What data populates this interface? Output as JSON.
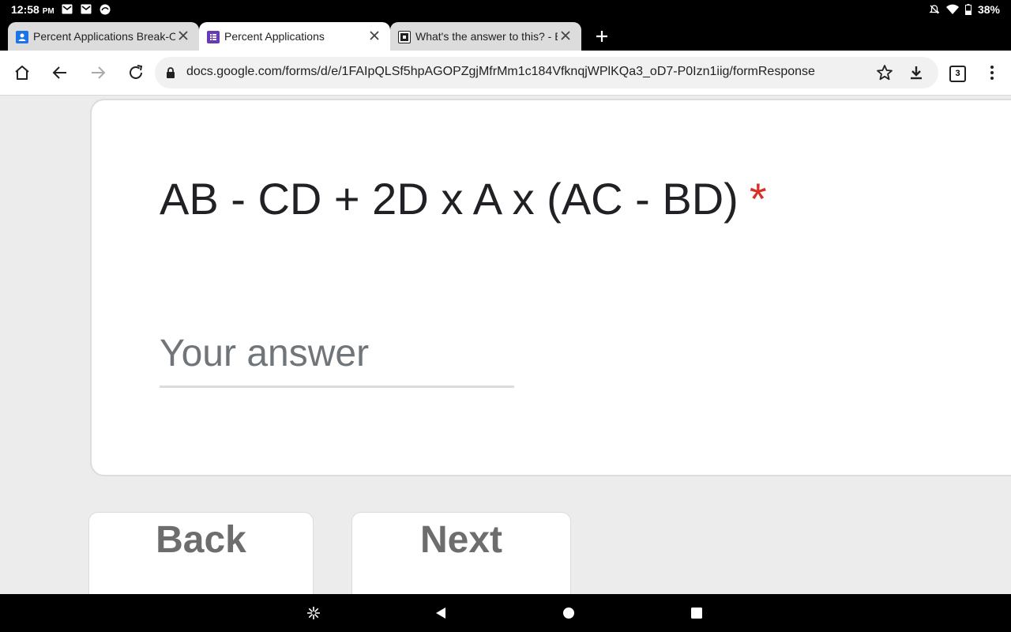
{
  "status_bar": {
    "time": "12:58",
    "ampm": "PM",
    "battery": "38%"
  },
  "tabs": [
    {
      "title": "Percent Applications Break-O",
      "active": false
    },
    {
      "title": "Percent Applications",
      "active": true
    },
    {
      "title": "What's the answer to this? - B",
      "active": false
    }
  ],
  "toolbar": {
    "url": "docs.google.com/forms/d/e/1FAIpQLSf5hpAGOPZgjMfrMm1c184VfknqjWPlKQa3_oD7-P0Izn1iig/formResponse",
    "tab_count": "3"
  },
  "form": {
    "question": "AB - CD + 2D x A x (AC - BD)",
    "required_mark": "*",
    "answer_placeholder": "Your answer",
    "back_label": "Back",
    "next_label": "Next"
  },
  "colors": {
    "required": "#d93025",
    "forms_purple": "#673ab7",
    "classroom_blue": "#1a73e8"
  }
}
